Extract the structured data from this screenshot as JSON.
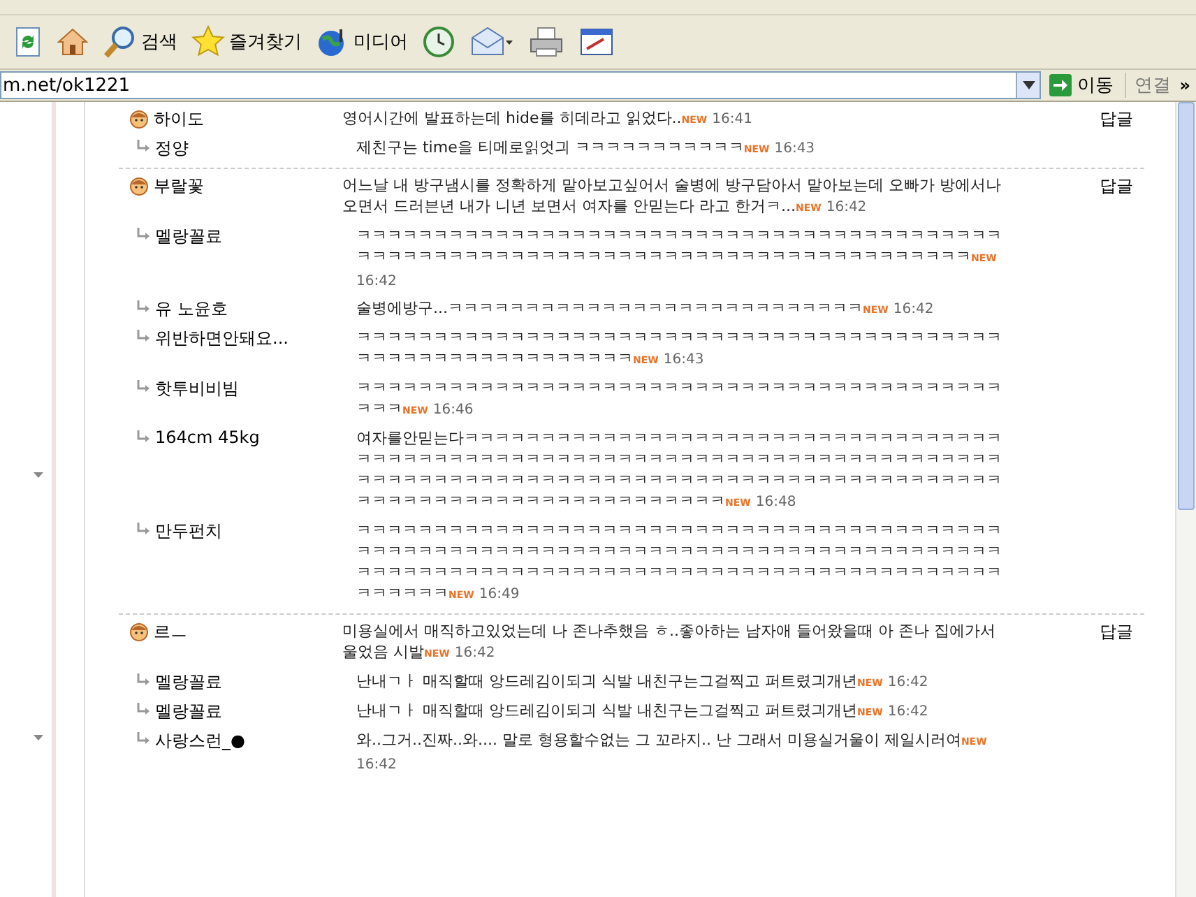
{
  "toolbar": {
    "buttons": [
      {
        "kind": "refresh"
      },
      {
        "kind": "home"
      },
      {
        "kind": "search",
        "label": "검색"
      },
      {
        "kind": "favorites",
        "label": "즐겨찾기"
      },
      {
        "kind": "media",
        "label": "미디어"
      },
      {
        "kind": "history"
      },
      {
        "kind": "mail"
      },
      {
        "kind": "print"
      },
      {
        "kind": "edit"
      }
    ]
  },
  "address_bar": {
    "value": "m.net/ok1221",
    "go_label": "이동",
    "links_label": "연결",
    "more": "»"
  },
  "threads": [
    {
      "author": "하이도",
      "text": "영어시간에 발표하는데 hide를 히데라고 읽었다..",
      "badge": "NEW",
      "time": "16:41",
      "reply_label": "답글",
      "replies": [
        {
          "author": "정양",
          "text": "제친구는 time을 티메로읽엇긔 ㅋㅋㅋㅋㅋㅋㅋㅋㅋㅋㅋ",
          "badge": "NEW",
          "time": "16:43"
        }
      ]
    },
    {
      "author": "부랄꽃",
      "text": "어느날 내 방구냄시를 정확하게 맡아보고싶어서 술병에 방구담아서 맡아보는데 오빠가 방에서나오면서 드러븐년 내가 니년 보면서 여자를 안믿는다 라고 한거ㅋ...",
      "badge": "NEW",
      "time": "16:42",
      "reply_label": "답글",
      "replies": [
        {
          "author": "멜랑꼴료",
          "text": "ㅋㅋㅋㅋㅋㅋㅋㅋㅋㅋㅋㅋㅋㅋㅋㅋㅋㅋㅋㅋㅋㅋㅋㅋㅋㅋㅋㅋㅋㅋㅋㅋㅋㅋㅋㅋㅋㅋㅋㅋㅋㅋㅋㅋㅋㅋㅋㅋㅋㅋㅋㅋㅋㅋㅋㅋㅋㅋㅋㅋㅋㅋㅋㅋㅋㅋㅋㅋㅋㅋㅋㅋㅋㅋㅋㅋㅋㅋㅋㅋㅋㅋ",
          "badge": "NEW",
          "time": "16:42"
        },
        {
          "author": "유 노윤호",
          "text": "술병에방구...ㅋㅋㅋㅋㅋㅋㅋㅋㅋㅋㅋㅋㅋㅋㅋㅋㅋㅋㅋㅋㅋㅋㅋㅋㅋㅋㅋ",
          "badge": "NEW",
          "time": "16:42"
        },
        {
          "author": "위반하면안돼요...",
          "text": "ㅋㅋㅋㅋㅋㅋㅋㅋㅋㅋㅋㅋㅋㅋㅋㅋㅋㅋㅋㅋㅋㅋㅋㅋㅋㅋㅋㅋㅋㅋㅋㅋㅋㅋㅋㅋㅋㅋㅋㅋㅋㅋㅋㅋㅋㅋㅋㅋㅋㅋㅋㅋㅋㅋㅋㅋㅋㅋㅋㅋ",
          "badge": "NEW",
          "time": "16:43"
        },
        {
          "author": "핫투비비빔",
          "text": "ㅋㅋㅋㅋㅋㅋㅋㅋㅋㅋㅋㅋㅋㅋㅋㅋㅋㅋㅋㅋㅋㅋㅋㅋㅋㅋㅋㅋㅋㅋㅋㅋㅋㅋㅋㅋㅋㅋㅋㅋㅋㅋㅋㅋㅋ",
          "badge": "NEW",
          "time": "16:46"
        },
        {
          "author": "164cm 45kg",
          "text": "여자를안믿는다ㅋㅋㅋㅋㅋㅋㅋㅋㅋㅋㅋㅋㅋㅋㅋㅋㅋㅋㅋㅋㅋㅋㅋㅋㅋㅋㅋㅋㅋㅋㅋㅋㅋㅋㅋㅋㅋㅋㅋㅋㅋㅋㅋㅋㅋㅋㅋㅋㅋㅋㅋㅋㅋㅋㅋㅋㅋㅋㅋㅋㅋㅋㅋㅋㅋㅋㅋㅋㅋㅋㅋㅋㅋㅋㅋㅋㅋㅋㅋㅋㅋㅋㅋㅋㅋㅋㅋㅋㅋㅋㅋㅋㅋㅋㅋㅋㅋㅋㅋㅋㅋㅋㅋㅋㅋㅋㅋㅋㅋㅋㅋㅋㅋㅋㅋㅋㅋㅋㅋㅋㅋㅋㅋㅋㅋㅋㅋㅋㅋㅋㅋㅋㅋㅋㅋㅋㅋㅋㅋㅋㅋㅋㅋ",
          "badge": "NEW",
          "time": "16:48"
        },
        {
          "author": "만두펀치",
          "text": "ㅋㅋㅋㅋㅋㅋㅋㅋㅋㅋㅋㅋㅋㅋㅋㅋㅋㅋㅋㅋㅋㅋㅋㅋㅋㅋㅋㅋㅋㅋㅋㅋㅋㅋㅋㅋㅋㅋㅋㅋㅋㅋㅋㅋㅋㅋㅋㅋㅋㅋㅋㅋㅋㅋㅋㅋㅋㅋㅋㅋㅋㅋㅋㅋㅋㅋㅋㅋㅋㅋㅋㅋㅋㅋㅋㅋㅋㅋㅋㅋㅋㅋㅋㅋㅋㅋㅋㅋㅋㅋㅋㅋㅋㅋㅋㅋㅋㅋㅋㅋㅋㅋㅋㅋㅋㅋㅋㅋㅋㅋㅋㅋㅋㅋㅋㅋㅋㅋㅋㅋㅋㅋㅋㅋㅋㅋㅋㅋㅋㅋㅋㅋ",
          "badge": "NEW",
          "time": "16:49"
        }
      ]
    },
    {
      "author": "르ㅡ",
      "text": "미용실에서 매직하고있었는데 나 존나추했음 ㅎ..좋아하는 남자애 들어왔을때 아 존나 집에가서 울었음 시발",
      "badge": "NEW",
      "time": "16:42",
      "reply_label": "답글",
      "replies": [
        {
          "author": "멜랑꼴료",
          "text": "난내ㄱㅏ 매직할때 앙드레김이되긔 식발 내친구는그걸찍고 퍼트렸긔개년",
          "badge": "NEW",
          "time": "16:42"
        },
        {
          "author": "멜랑꼴료",
          "text": "난내ㄱㅏ 매직할때 앙드레김이되긔 식발 내친구는그걸찍고 퍼트렸긔개년",
          "badge": "NEW",
          "time": "16:42"
        },
        {
          "author": "사랑스런_●",
          "text": "와..그거..진짜..와.... 말로 형용할수없는 그 꼬라지.. 난 그래서 미용실거울이 제일시러여",
          "badge": "NEW",
          "time": "16:42"
        }
      ]
    }
  ]
}
